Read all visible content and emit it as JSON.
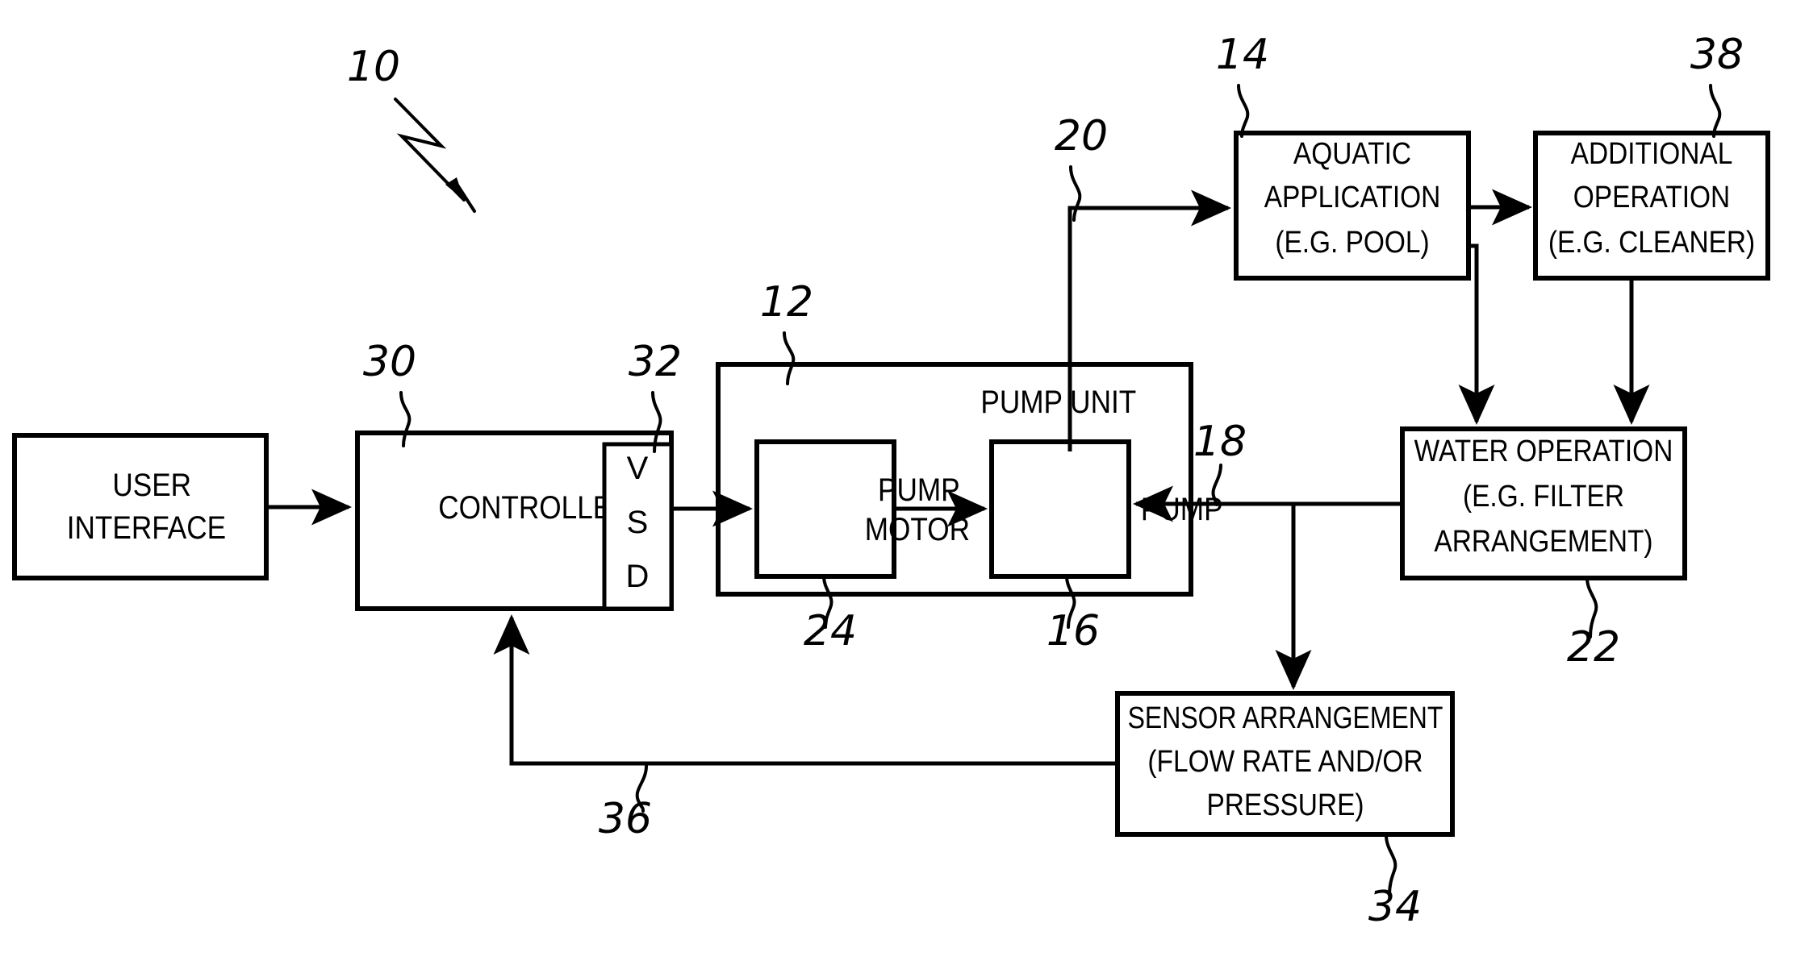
{
  "figure": {
    "type": "patent-block-diagram",
    "title_numeral": "10",
    "background_color": "#ffffff",
    "line_color": "#000000"
  },
  "blocks": {
    "user_interface": {
      "lines": [
        "USER",
        "INTERFACE"
      ],
      "ref": null
    },
    "controller": {
      "lines": [
        "CONTROLLER"
      ],
      "ref": "30"
    },
    "vsd": {
      "letters": [
        "V",
        "S",
        "D"
      ],
      "ref": "32"
    },
    "pump_unit": {
      "lines": [
        "PUMP UNIT"
      ],
      "ref": "12"
    },
    "pump_motor": {
      "lines": [
        "PUMP",
        "MOTOR"
      ],
      "ref": "24"
    },
    "pump": {
      "lines": [
        "PUMP"
      ],
      "ref": "16"
    },
    "aquatic_application": {
      "lines": [
        "AQUATIC",
        "APPLICATION",
        "(E.G. POOL)"
      ],
      "ref": "14"
    },
    "additional_operation": {
      "lines": [
        "ADDITIONAL",
        "OPERATION",
        "(E.G. CLEANER)"
      ],
      "ref": "38"
    },
    "water_operation": {
      "lines": [
        "WATER OPERATION",
        "(E.G. FILTER",
        "ARRANGEMENT)"
      ],
      "ref": "22"
    },
    "sensor_arrangement": {
      "lines": [
        "SENSOR ARRANGEMENT",
        "(FLOW RATE AND/OR",
        "PRESSURE)"
      ],
      "ref": "34"
    }
  },
  "reference_numerals": {
    "figure": "10",
    "pump_unit": "12",
    "aquatic_application": "14",
    "pump": "16",
    "return_line": "18",
    "supply_line": "20",
    "water_operation": "22",
    "pump_motor": "24",
    "controller": "30",
    "vsd": "32",
    "sensor_arrangement": "34",
    "feedback_line": "36",
    "additional_operation": "38"
  }
}
